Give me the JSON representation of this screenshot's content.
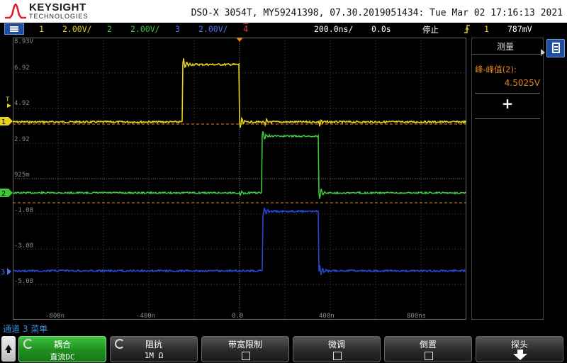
{
  "header": {
    "logo_text": "KEYSIGHT",
    "logo_sub": "TECHNOLOGIES",
    "title": "DSO-X 3054T, MY59241398, 07.30.2019051434: Tue Mar 02 17:16:13 2021"
  },
  "status": {
    "ch1_num": "1",
    "ch1_scale": "2.00V/",
    "ch2_num": "2",
    "ch2_scale": "2.00V/",
    "ch3_num": "3",
    "ch3_scale": "2.00V/",
    "trigger_channel": "4",
    "timebase": "200.0ns/",
    "delay": "0.0s",
    "run_state": "停止",
    "trigger_source": "1",
    "trigger_level": "787mV"
  },
  "graticule": {
    "y_labels": [
      "8.93V",
      "6.92",
      "4.92",
      "2.92",
      "925m",
      "-1.08",
      "-3.08",
      "-5.08"
    ],
    "x_labels": [
      "-800n",
      "-400n",
      "0.0",
      "400n",
      "800ns"
    ],
    "ch1_marker": "1",
    "ch2_marker": "2",
    "ch3_marker": "3",
    "trigger_marker": "T"
  },
  "measurement": {
    "panel_title": "测量",
    "label": "峰-峰值(2):",
    "value": "4.5025V",
    "add_symbol": "+"
  },
  "channel_menu": "通道 3 菜单",
  "softkeys": [
    {
      "label": "耦合",
      "value": "直流DC"
    },
    {
      "label": "阻抗",
      "value": "1M Ω"
    },
    {
      "label": "带宽限制",
      "value": ""
    },
    {
      "label": "微调",
      "value": ""
    },
    {
      "label": "倒置",
      "value": ""
    },
    {
      "label": "探头",
      "value": ""
    }
  ],
  "colors": {
    "ch1": "#e6d21e",
    "ch2": "#3cc83c",
    "ch3": "#2846d2",
    "trigger": "#e04040",
    "measure": "#e8861c",
    "grid": "#5a5a5a"
  }
}
